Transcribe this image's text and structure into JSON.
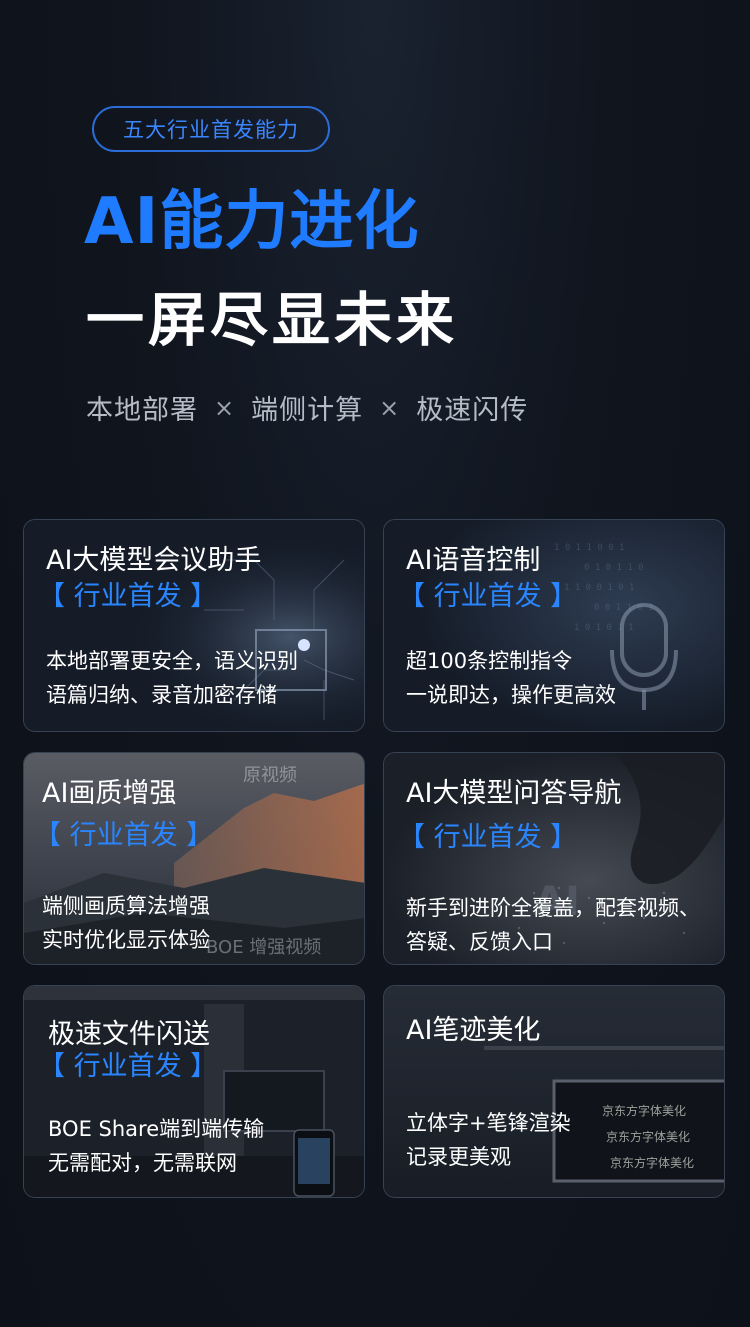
{
  "header": {
    "badge": "五大行业首发能力",
    "title": "AI能力进化",
    "subtitle": "一屏尽显未来",
    "tagline": [
      "本地部署",
      "端侧计算",
      "极速闪传"
    ],
    "tagline_separator": "×"
  },
  "colors": {
    "accent": "#1f7bff",
    "badge_border": "#2b6cd6",
    "background": "#10151e",
    "text_secondary": "#b6bcc6"
  },
  "cards": [
    {
      "title": "AI大模型会议助手",
      "flag": "【 行业首发 】",
      "desc": [
        "本地部署更安全，语义识别",
        "语篇归纳、录音加密存储"
      ],
      "icon": "chip-icon"
    },
    {
      "title": "AI语音控制",
      "flag": "【 行业首发 】",
      "desc": [
        "超100条控制指令",
        "一说即达，操作更高效"
      ],
      "icon": "microphone-icon"
    },
    {
      "title": "AI画质增强",
      "flag": "【 行业首发 】",
      "desc": [
        "端侧画质算法增强",
        "实时优化显示体验"
      ],
      "overlay_top": "原视频",
      "overlay_bottom": "BOE 增强视频",
      "icon": "mountain-image"
    },
    {
      "title": "AI大模型问答导航",
      "flag": "【 行业首发 】",
      "desc": [
        "新手到进阶全覆盖，配套视频、",
        "答疑、反馈入口"
      ],
      "icon": "ai-finger-image"
    },
    {
      "title": "极速文件闪送",
      "flag": "【 行业首发 】",
      "desc": [
        "BOE Share端到端传输",
        "无需配对，无需联网"
      ],
      "icon": "phone-icon"
    },
    {
      "title": "AI笔迹美化",
      "flag": "",
      "desc": [
        "立体字+笔锋渲染",
        "记录更美观"
      ],
      "handwriting": [
        "京东方字体美化",
        "京东方字体美化",
        "京东方字体美化"
      ],
      "icon": "whiteboard-image"
    }
  ]
}
